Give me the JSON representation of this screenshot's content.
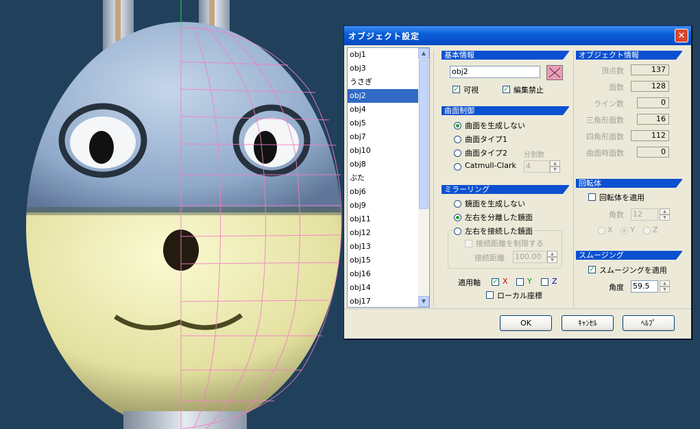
{
  "dialog": {
    "title": "オブジェクト設定",
    "close_glyph": "✕"
  },
  "object_list": {
    "items": [
      "obj1",
      "obj3",
      "うさぎ",
      "obj2",
      "obj4",
      "obj5",
      "obj7",
      "obj10",
      "obj8",
      "ぶた",
      "obj6",
      "obj9",
      "obj11",
      "obj12",
      "obj13",
      "obj15",
      "obj16",
      "obj14",
      "obj17"
    ],
    "selected": "obj2"
  },
  "basic_info": {
    "header": "基本情報",
    "name_value": "obj2",
    "color": "#ef9cb8",
    "visible_label": "可視",
    "visible_checked": true,
    "lock_label": "編集禁止",
    "lock_checked": true
  },
  "surface": {
    "header": "曲面制御",
    "options": [
      "曲面を生成しない",
      "曲面タイプ1",
      "曲面タイプ2",
      "Catmull-Clark"
    ],
    "selected_index": 0,
    "divisions_label": "分割数",
    "divisions_value": "4"
  },
  "mirroring": {
    "header": "ミラーリング",
    "options": [
      "鏡面を生成しない",
      "左右を分離した鏡面",
      "左右を接続した鏡面"
    ],
    "selected_index": 1,
    "limit_label": "接続距離を制限する",
    "distance_label": "接続距離",
    "distance_value": "100.00",
    "axis_label": "適用軸",
    "axis_x": "X",
    "axis_y": "Y",
    "axis_z": "Z",
    "axis_x_checked": true,
    "local_label": "ローカル座標"
  },
  "object_info": {
    "header": "オブジェクト情報",
    "rows": [
      {
        "label": "頂点数",
        "value": "137"
      },
      {
        "label": "面数",
        "value": "128"
      },
      {
        "label": "ライン数",
        "value": "0"
      },
      {
        "label": "三角形面数",
        "value": "16"
      },
      {
        "label": "四角形面数",
        "value": "112"
      },
      {
        "label": "曲面時面数",
        "value": "0"
      }
    ]
  },
  "rotation": {
    "header": "回転体",
    "apply_label": "回転体を適用",
    "angle_label": "角数",
    "angle_value": "12",
    "axis_x": "X",
    "axis_y": "Y",
    "axis_z": "Z"
  },
  "smoothing": {
    "header": "スムージング",
    "apply_label": "スムージングを適用",
    "apply_checked": true,
    "angle_label": "角度",
    "angle_value": "59.5"
  },
  "buttons": {
    "ok": "OK",
    "cancel": "ｷｬﾝｾﾙ",
    "help": "ﾍﾙﾌﾟ"
  }
}
